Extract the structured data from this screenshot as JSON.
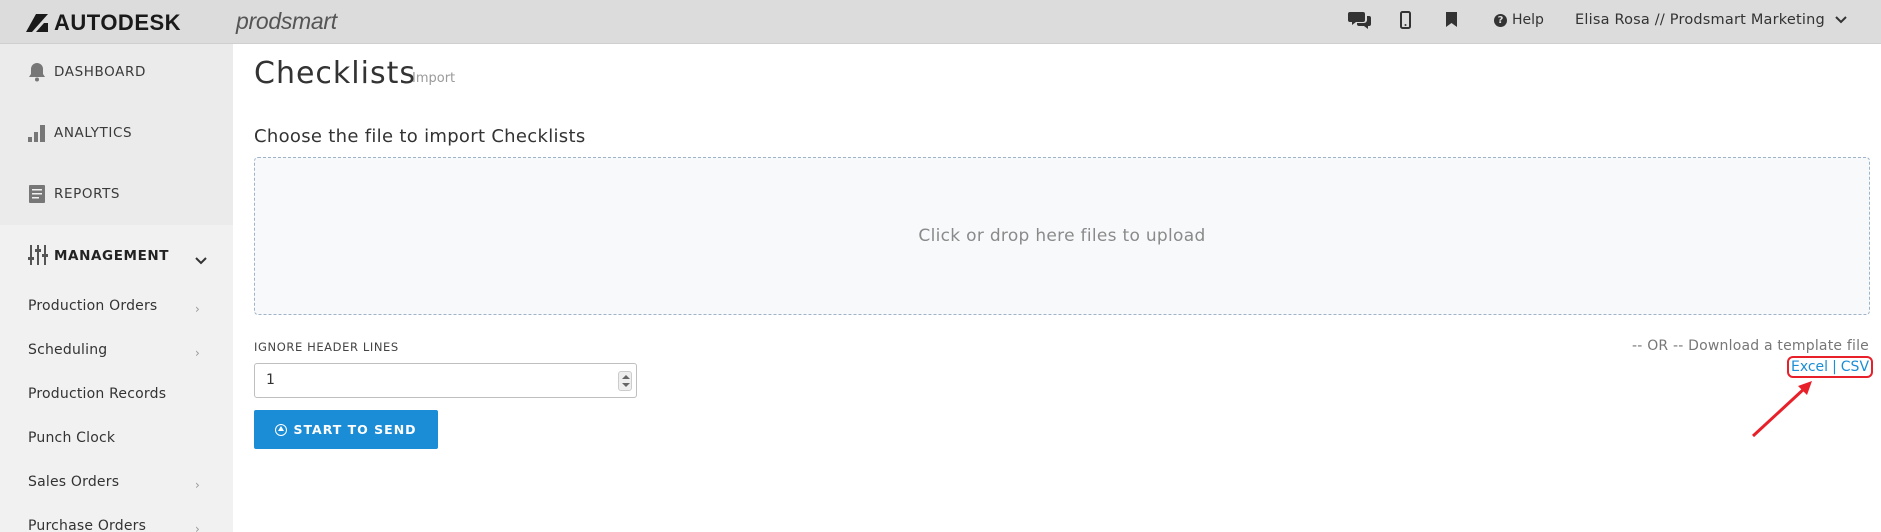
{
  "topbar": {
    "brand": "AUTODESK",
    "product": "prodsmart",
    "icons": [
      "chat-icon",
      "mobile-icon",
      "bookmark-icon"
    ],
    "help_label": "Help",
    "user_label": "Elisa Rosa // Prodsmart Marketing"
  },
  "sidebar": {
    "top_items": [
      {
        "label": "DASHBOARD",
        "icon": "bell-icon"
      },
      {
        "label": "ANALYTICS",
        "icon": "bar-chart-icon"
      },
      {
        "label": "REPORTS",
        "icon": "report-icon"
      }
    ],
    "management": {
      "label": "MANAGEMENT",
      "icon": "sliders-icon"
    },
    "sub_items": [
      {
        "label": "Production Orders",
        "has_arrow": true
      },
      {
        "label": "Scheduling",
        "has_arrow": true
      },
      {
        "label": "Production Records",
        "has_arrow": false
      },
      {
        "label": "Punch Clock",
        "has_arrow": false
      },
      {
        "label": "Sales Orders",
        "has_arrow": true
      },
      {
        "label": "Purchase Orders",
        "has_arrow": true
      }
    ]
  },
  "main": {
    "title": "Checklists",
    "subtitle": "Import",
    "section_title": "Choose the file to import Checklists",
    "dropzone_text": "Click or drop here files to upload",
    "ignore_header_label": "IGNORE HEADER LINES",
    "ignore_header_value": "1",
    "send_button": "START TO SEND",
    "template_text": "-- OR -- Download a template file",
    "excel_link": "Excel",
    "csv_link": "CSV",
    "separator": "|"
  },
  "colors": {
    "topbar_bg": "#dcdcdc",
    "sidebar_bg": "#f1f1f1",
    "accent": "#1b8dd6",
    "annotation": "#e8202a"
  }
}
